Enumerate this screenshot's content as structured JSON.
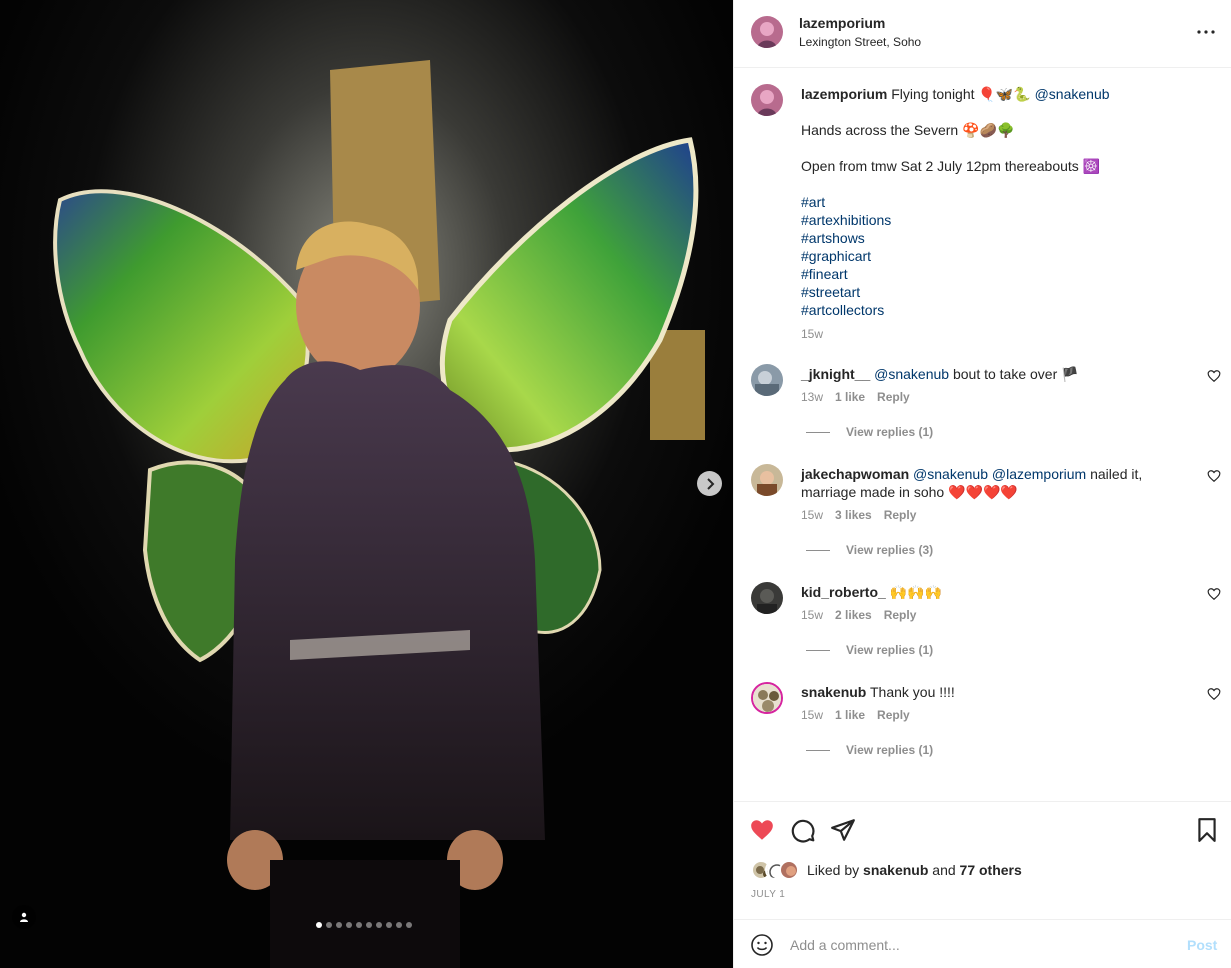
{
  "post": {
    "username": "lazemporium",
    "location": "Lexington Street, Soho"
  },
  "media": {
    "slide_count": 10,
    "active_slide": 1
  },
  "caption": {
    "username": "lazemporium",
    "line1_text": "Flying tonight 🎈🦋🐍",
    "line1_mention": "@snakenub",
    "line2": "Hands across the Severn 🍄🥔🌳",
    "line3": "Open from tmw Sat 2 July 12pm thereabouts ☸️",
    "hashtags": [
      "#art",
      "#artexhibitions",
      "#artshows",
      "#graphicart",
      "#fineart",
      "#streetart",
      "#artcollectors"
    ],
    "time": "15w"
  },
  "comments": [
    {
      "username": "_jknight__",
      "mentions": "@snakenub",
      "text": "bout to take over 🏴",
      "time": "13w",
      "likes": "1 like",
      "reply": "Reply",
      "view_replies": "View replies (1)"
    },
    {
      "username": "jakechapwoman",
      "mentions": "@snakenub @lazemporium",
      "text": "nailed it, marriage made in soho ❤️❤️❤️❤️",
      "time": "15w",
      "likes": "3 likes",
      "reply": "Reply",
      "view_replies": "View replies (3)"
    },
    {
      "username": "kid_roberto_",
      "mentions": "",
      "text": "🙌🙌🙌",
      "time": "15w",
      "likes": "2 likes",
      "reply": "Reply",
      "view_replies": "View replies (1)"
    },
    {
      "username": "snakenub",
      "mentions": "",
      "text": "Thank you !!!!",
      "time": "15w",
      "likes": "1 like",
      "reply": "Reply",
      "view_replies": "View replies (1)"
    }
  ],
  "likes": {
    "prefix": "Liked by",
    "user": "snakenub",
    "joiner": "and",
    "others": "77 others"
  },
  "date": "JULY 1",
  "add_comment": {
    "placeholder": "Add a comment...",
    "post_label": "Post"
  },
  "colors": {
    "link": "#00376b",
    "like_red": "#ed4956",
    "muted": "#8e8e8e",
    "post_disabled": "#b2dffc"
  },
  "icons": {
    "more": "more-horizontal-icon",
    "next": "chevron-right-icon",
    "tag": "user-tag-icon",
    "like": "heart-filled-icon",
    "comment": "comment-bubble-icon",
    "share": "paper-plane-icon",
    "save": "bookmark-icon",
    "emoji": "smiley-icon"
  }
}
